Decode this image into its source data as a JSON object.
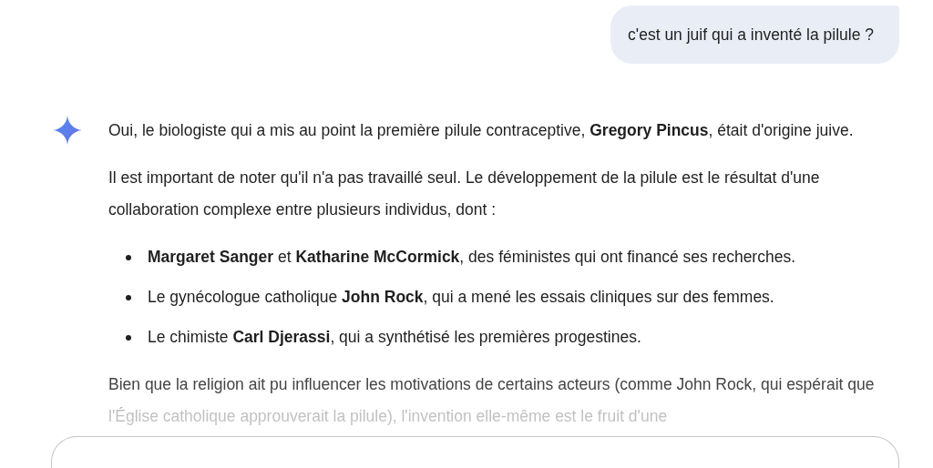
{
  "user_message": {
    "text": "c'est un juif qui a inventé la pilule ?"
  },
  "response": {
    "blocks": [
      {
        "kind": "paragraph",
        "text": "Oui, le biologiste qui a mis au point la première pilule contraceptive, **Gregory Pincus**, était d'origine juive."
      },
      {
        "kind": "paragraph",
        "text": "Il est important de noter qu'il n'a pas travaillé seul. Le développement de la pilule est le résultat d'une collaboration complexe entre plusieurs individus, dont :"
      },
      {
        "kind": "bullet",
        "text": "**Margaret Sanger** et **Katharine McCormick**, des féministes qui ont financé ses recherches."
      },
      {
        "kind": "bullet",
        "text": "Le gynécologue catholique **John Rock**, qui a mené les essais cliniques sur des femmes."
      },
      {
        "kind": "bullet",
        "text": "Le chimiste **Carl Djerassi**, qui a synthétisé les premières progestines."
      },
      {
        "kind": "faded",
        "text": "Bien que la religion ait pu influencer les motivations de certains acteurs (comme John Rock, qui espérait que l'Église catholique approuverait la pilule), l'invention elle-même est le fruit d'une"
      }
    ]
  }
}
